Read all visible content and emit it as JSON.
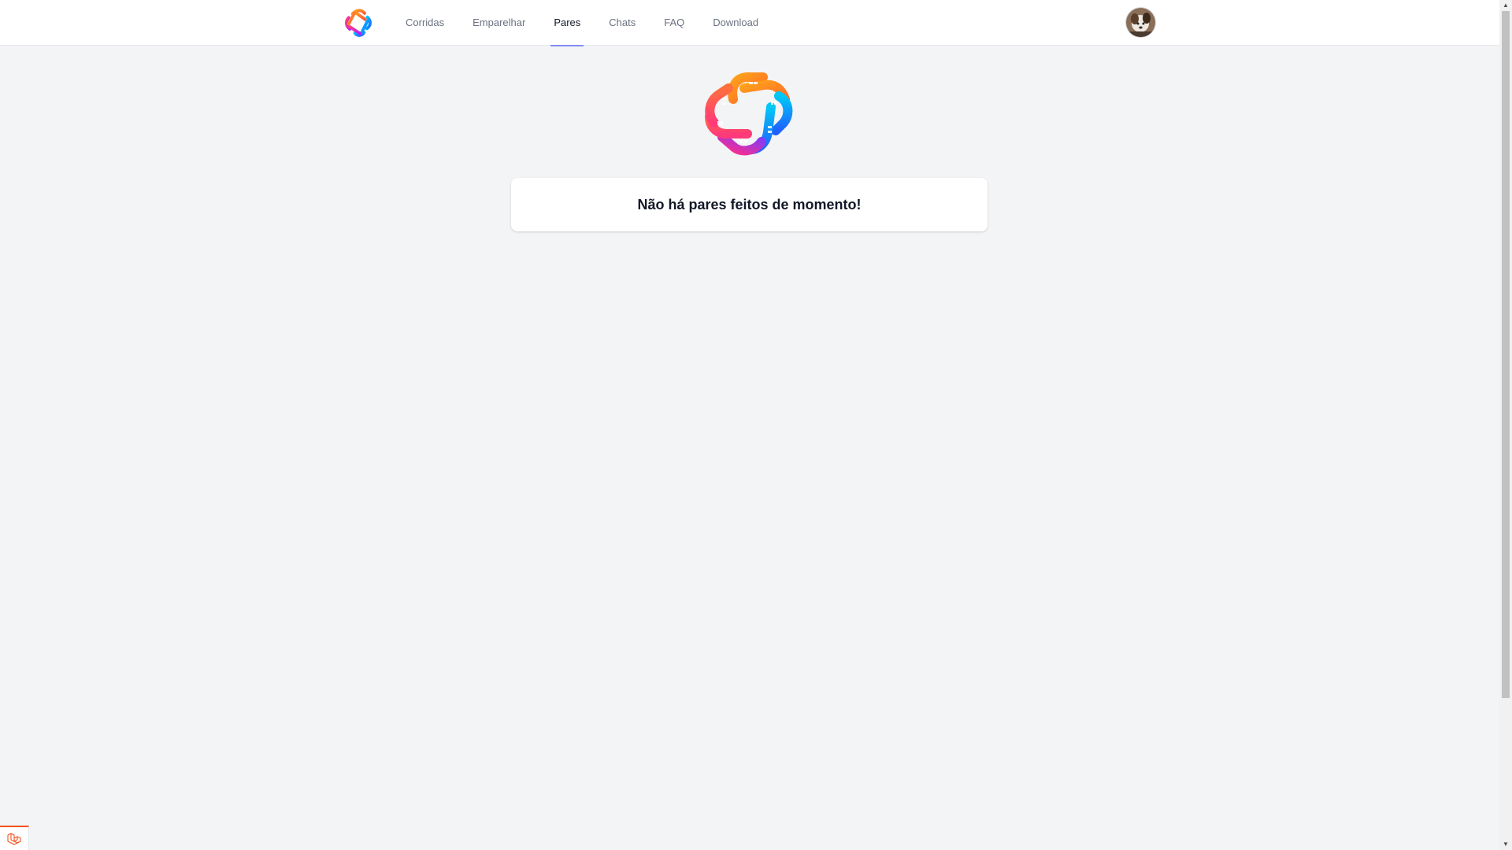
{
  "nav": {
    "links": [
      {
        "label": "Corridas",
        "active": false
      },
      {
        "label": "Emparelhar",
        "active": false
      },
      {
        "label": "Pares",
        "active": true
      },
      {
        "label": "Chats",
        "active": false
      },
      {
        "label": "FAQ",
        "active": false
      },
      {
        "label": "Download",
        "active": false
      }
    ],
    "accent_underline": "#818cf8"
  },
  "main": {
    "empty_message": "Não há pares feitos de momento!"
  },
  "icons": {
    "brand": "brand-logo-icon",
    "avatar": "user-avatar",
    "debug": "laravel-debugbar-icon"
  },
  "colors": {
    "background": "#f3f4f6",
    "card": "#ffffff",
    "text_muted": "#6b7280",
    "text_active": "#111827",
    "debug_accent": "#f4511e"
  }
}
